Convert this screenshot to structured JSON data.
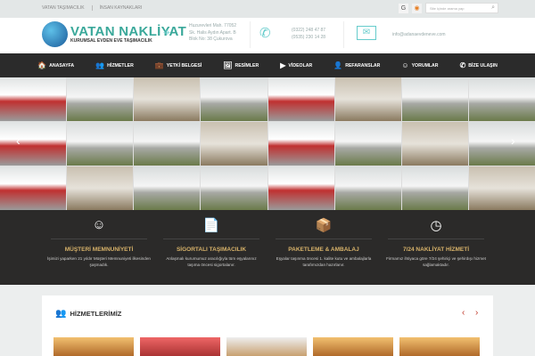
{
  "topbar": {
    "links": [
      "VATAN TAŞIMACILIK",
      "İNSAN KAYNAKLARI"
    ],
    "search_placeholder": "Site içinde arama yap"
  },
  "logo": {
    "title": "VATAN NAKLİYAT",
    "subtitle": "KURUMSAL EVDEN EVE TAŞIMACILIK"
  },
  "contact": {
    "address": [
      "Huzurevleri Mah. 77052",
      "Sk. Halis Aydın Apart. B",
      "Blok No: 38 Çukurova"
    ],
    "phones": [
      "(0322) 248 47 87",
      "(0535) 230 14 28"
    ],
    "email": "info@adanaevdeneve.com"
  },
  "nav": [
    {
      "label": "ANASAYFA",
      "icon": "🏠"
    },
    {
      "label": "HİZMETLER",
      "icon": "👥"
    },
    {
      "label": "YETKİ BELGESİ",
      "icon": "💼"
    },
    {
      "label": "RESİMLER",
      "icon": "🖼"
    },
    {
      "label": "VİDEOLAR",
      "icon": "▶"
    },
    {
      "label": "REFARANSLAR",
      "icon": "👤"
    },
    {
      "label": "YORUMLAR",
      "icon": "☺"
    },
    {
      "label": "BİZE ULAŞIN",
      "icon": "✆"
    }
  ],
  "features": [
    {
      "icon": "☺",
      "title": "MÜŞTERİ MEMNUNİYETİ",
      "text": "İşimizi yaparken 21 yıldır Müşteri Memnuniyeti ilkesinden şaşmadık."
    },
    {
      "icon": "📄",
      "title": "SİGORTALI TAŞIMACILIK",
      "text": "Anlaşmalı kurumumuz aracılığıyla tüm eşyalarınız taşıma öncesi sigortalanır."
    },
    {
      "icon": "📦",
      "title": "PAKETLEME & AMBALAJ",
      "text": "Eşyalar taşınma öncesi 1. kalite kutu ve ambalajlarla tarafımızdan hazırlanır."
    },
    {
      "icon": "◷",
      "title": "7/24 NAKLİYAT HİZMETİ",
      "text": "Firmamız ihtiyaca göre 7/24 şehiriçi ve şehirdışı hizmet sağlamaktadır."
    }
  ],
  "services": {
    "title": "HİZMETLERİMİZ"
  }
}
